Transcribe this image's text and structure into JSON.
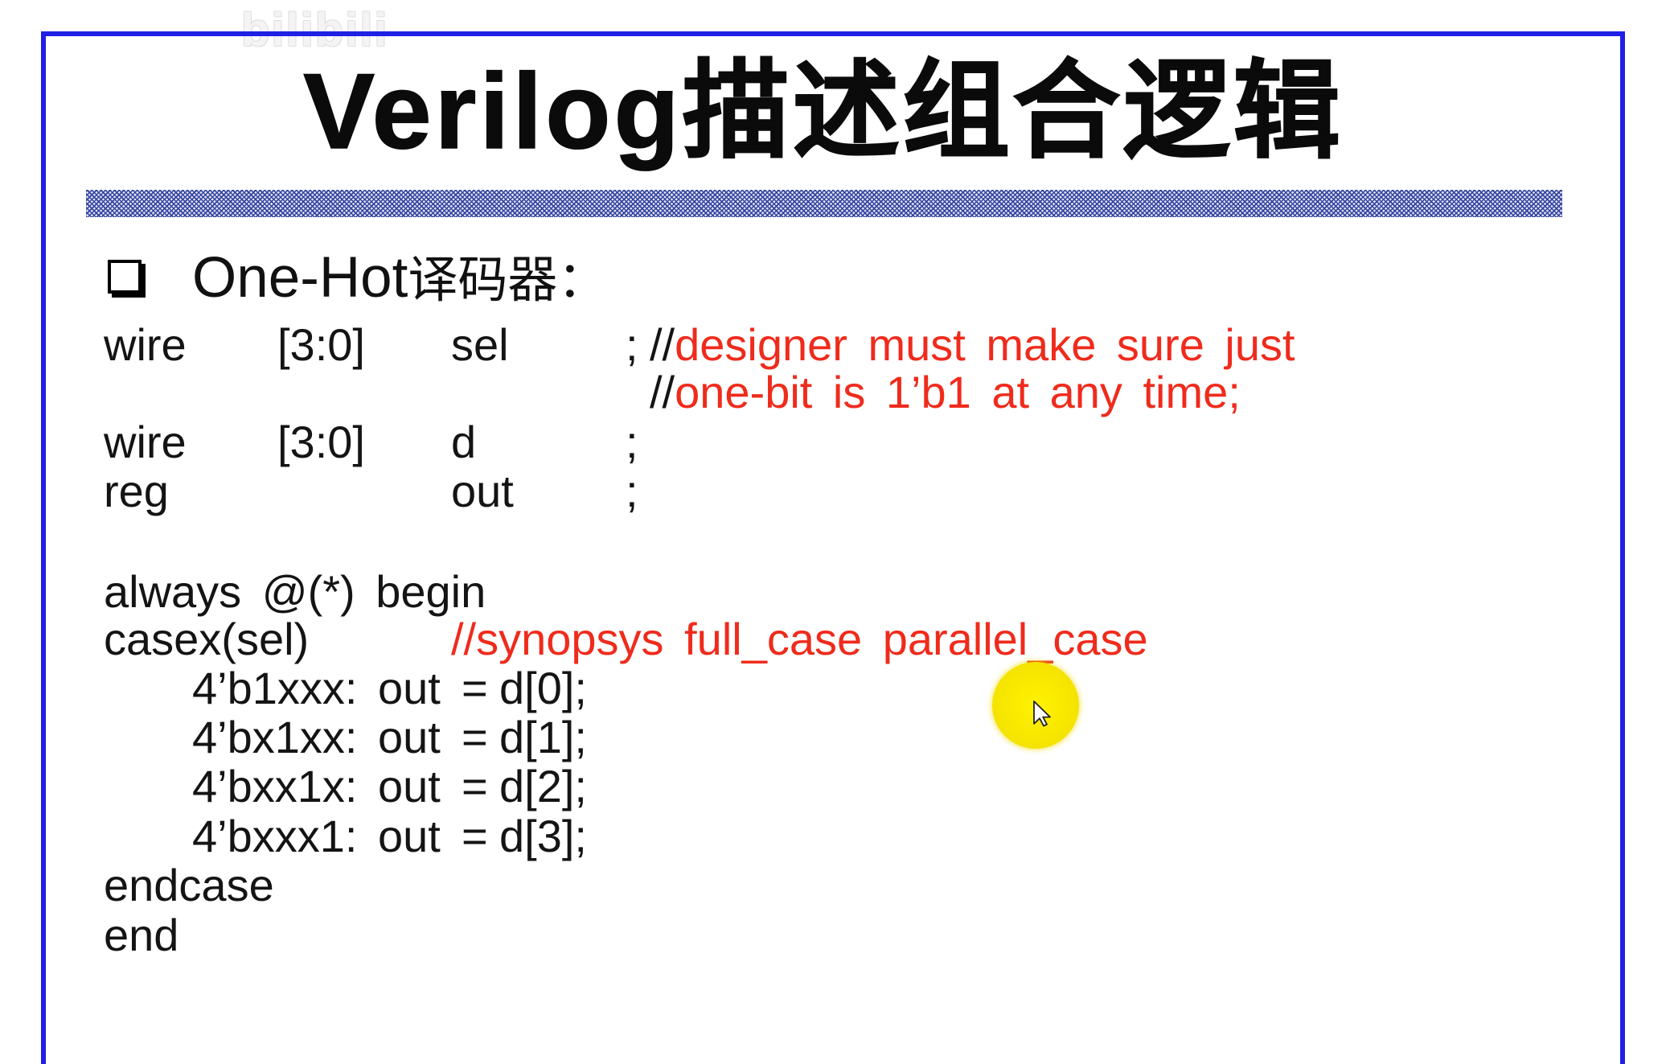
{
  "watermark": {
    "logo": "bilibili"
  },
  "slide": {
    "title": "Verilog描述组合逻辑",
    "heading": {
      "bullet_icon": "hollow-square-bullet-icon",
      "latin": "One-Hot",
      "cjk": "译码器："
    }
  },
  "code": {
    "declarations": [
      {
        "keyword": "wire",
        "range": "[3:0]",
        "name": "sel",
        "terminator": ";",
        "comment_lines": [
          {
            "marker": "//",
            "text": "designer must make sure just"
          },
          {
            "marker": "//",
            "text": "one-bit is 1’b1 at any time;"
          }
        ]
      },
      {
        "keyword": "wire",
        "range": "[3:0]",
        "name": "d",
        "terminator": ";"
      },
      {
        "keyword": "reg",
        "name": "out",
        "terminator": ";"
      }
    ],
    "always_header": "always @(*) begin",
    "case_header": "casex(sel)",
    "case_directive": "//synopsys full_case parallel_case",
    "case_items": [
      {
        "pattern": "4’b1xxx:",
        "lhs": "out",
        "op": "=",
        "rhs": "d[0];"
      },
      {
        "pattern": "4’bx1xx:",
        "lhs": "out",
        "op": "=",
        "rhs": "d[1];"
      },
      {
        "pattern": "4’bxx1x:",
        "lhs": "out",
        "op": "=",
        "rhs": "d[2];"
      },
      {
        "pattern": "4’bxxx1:",
        "lhs": "out",
        "op": "=",
        "rhs": "d[3];"
      }
    ],
    "case_end": "endcase",
    "block_end": "end"
  },
  "pointer": {
    "icon": "arrow-cursor-icon",
    "highlight": "yellow-cursor-highlight"
  },
  "colors": {
    "frame": "#1f1fe6",
    "comment": "#ef2b1c",
    "text": "#141414",
    "highlight": "#f6e500"
  }
}
